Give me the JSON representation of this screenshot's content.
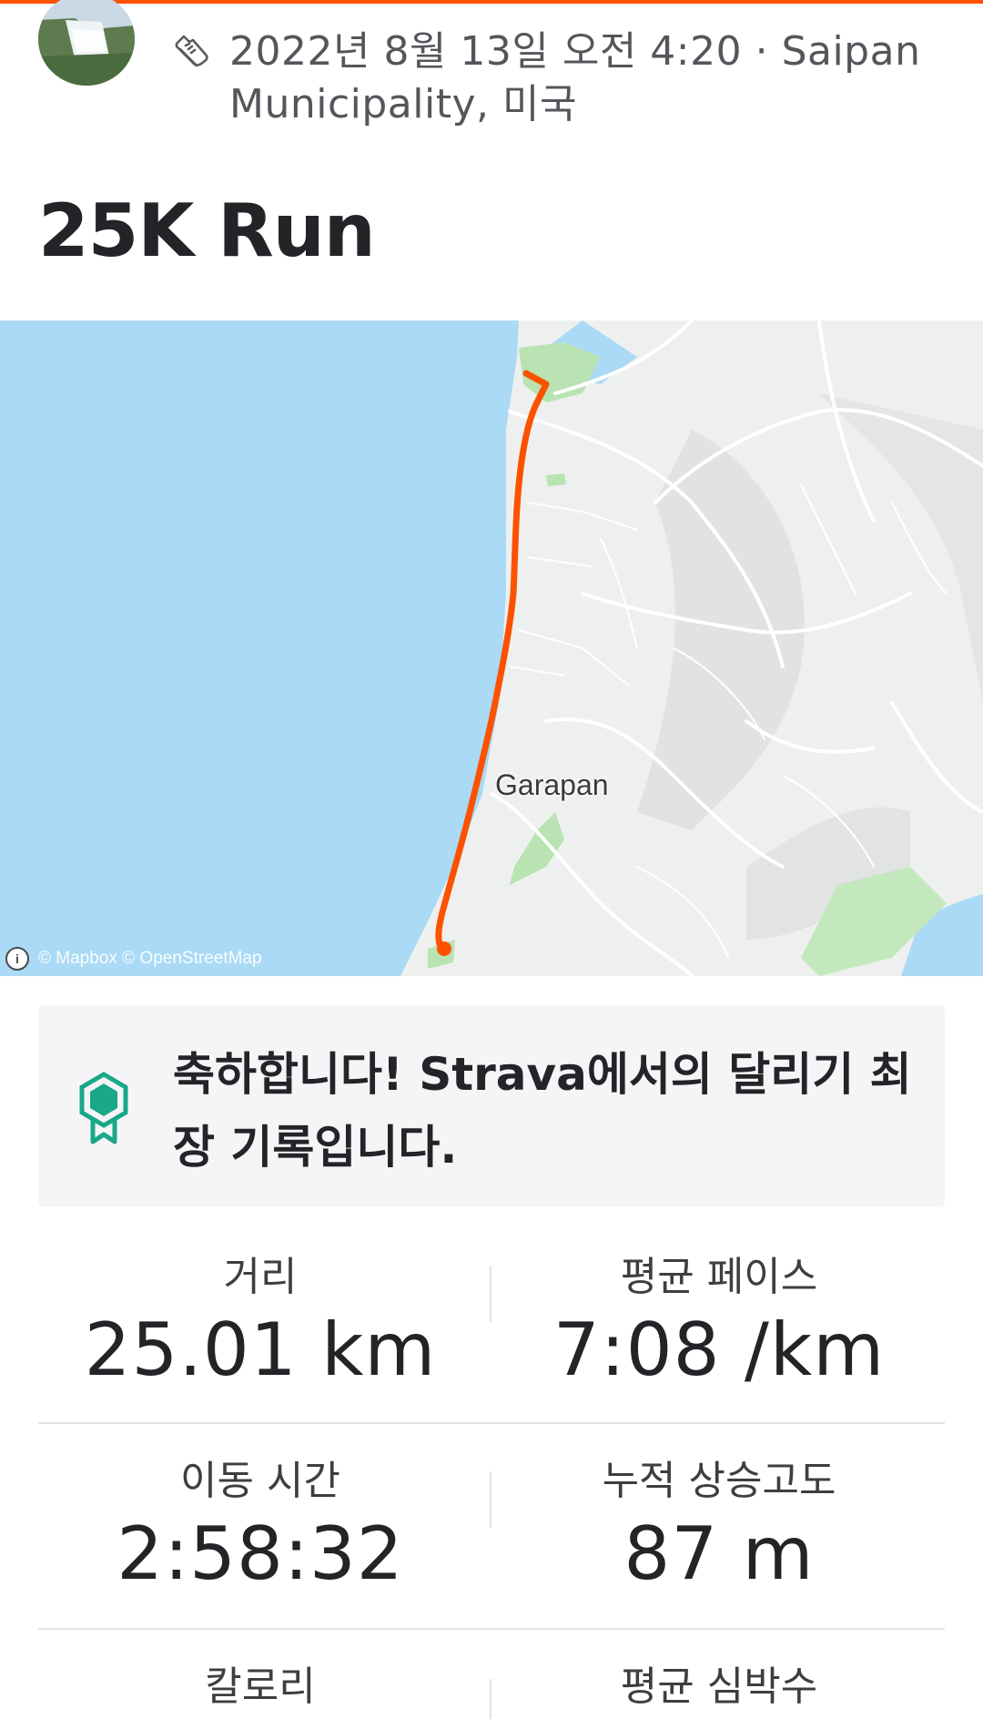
{
  "header": {
    "avatar_icon": "waterfall-photo-avatar",
    "activity_icon": "running-shoe-icon",
    "meta_text": "2022년 8월 13일 오전 4:20 · Saipan Municipality, 미국"
  },
  "activity": {
    "title": "25K Run"
  },
  "map": {
    "place_label": "Garapan",
    "attribution": "© Mapbox © OpenStreetMap",
    "route_color": "#fc5200"
  },
  "achievement": {
    "icon": "medal-icon",
    "text": "축하합니다! Strava에서의 달리기 최장 기록입니다."
  },
  "stats": {
    "distance": {
      "label": "거리",
      "value": "25.01 km"
    },
    "avg_pace": {
      "label": "평균 페이스",
      "value": "7:08 /km"
    },
    "moving_time": {
      "label": "이동 시간",
      "value": "2:58:32"
    },
    "elevation_gain": {
      "label": "누적 상승고도",
      "value": "87 m"
    },
    "calories": {
      "label": "칼로리"
    },
    "avg_heart_rate": {
      "label": "평균 심박수"
    }
  },
  "colors": {
    "brand": "#fc5200",
    "water": "#aadaf5",
    "medal": "#1aa887"
  }
}
